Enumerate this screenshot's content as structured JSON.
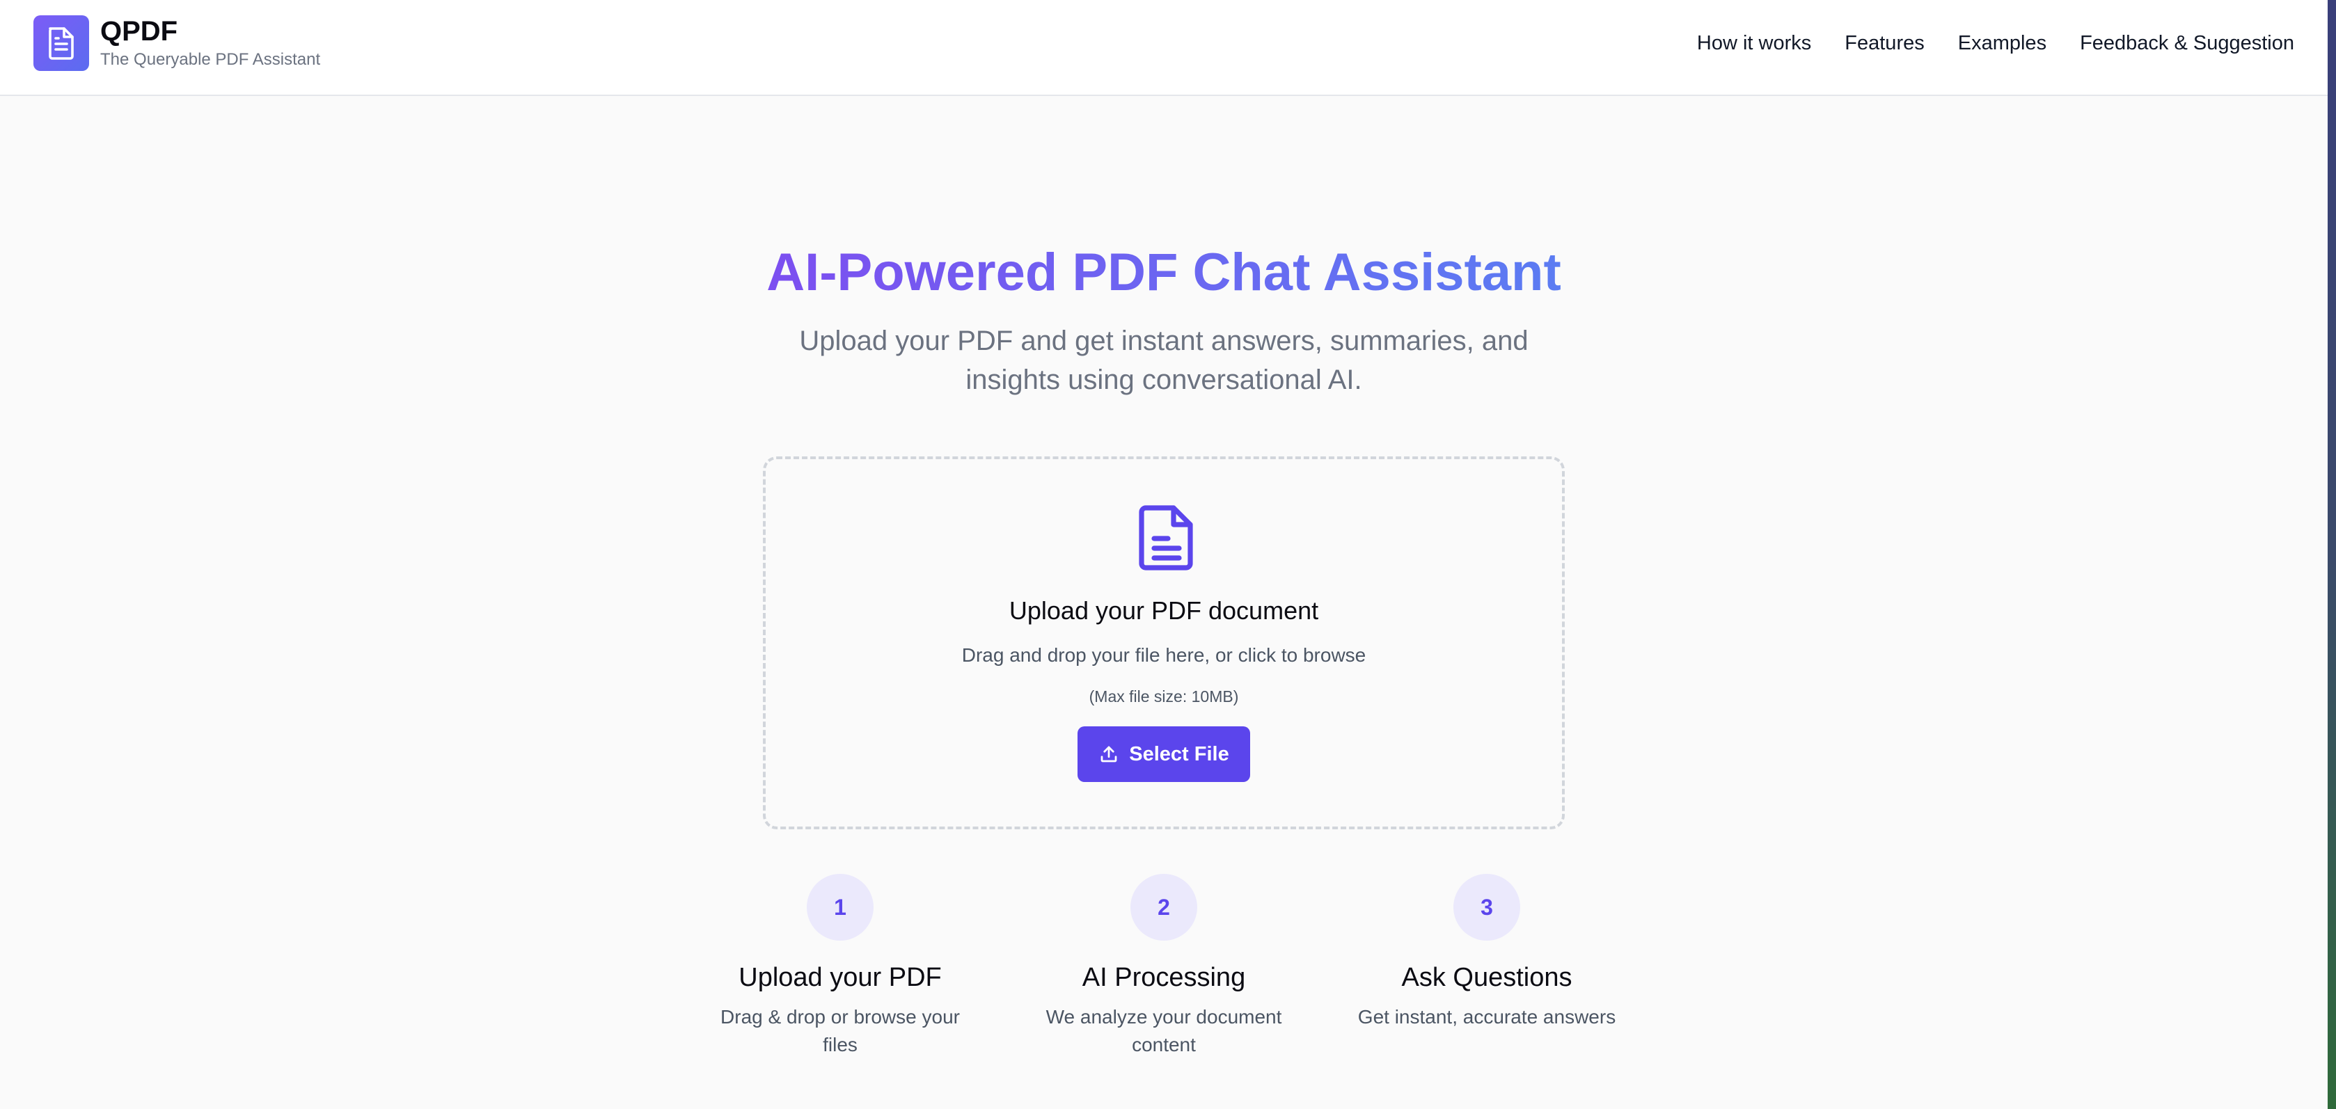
{
  "header": {
    "brand_name": "QPDF",
    "brand_tagline": "The Queryable PDF Assistant",
    "logo_icon": "document-icon",
    "nav": [
      {
        "label": "How it works"
      },
      {
        "label": "Features"
      },
      {
        "label": "Examples"
      },
      {
        "label": "Feedback & Suggestion"
      }
    ]
  },
  "hero": {
    "title": "AI-Powered PDF Chat Assistant",
    "subtitle": "Upload your PDF and get instant answers, summaries, and insights using conversational AI."
  },
  "upload": {
    "icon": "document-icon",
    "title": "Upload your PDF document",
    "hint": "Drag and drop your file here, or click to browse",
    "limit": "(Max file size: 10MB)",
    "button_label": "Select File",
    "button_icon": "upload-icon"
  },
  "steps": [
    {
      "number": "1",
      "title": "Upload your PDF",
      "desc": "Drag & drop or browse your files"
    },
    {
      "number": "2",
      "title": "AI Processing",
      "desc": "We analyze your document content"
    },
    {
      "number": "3",
      "title": "Ask Questions",
      "desc": "Get instant, accurate answers"
    }
  ],
  "colors": {
    "accent": "#5b45ec",
    "gradient_start": "#7c4ff0",
    "gradient_end": "#5b7cf2",
    "step_circle_bg": "#ebe9fc"
  }
}
